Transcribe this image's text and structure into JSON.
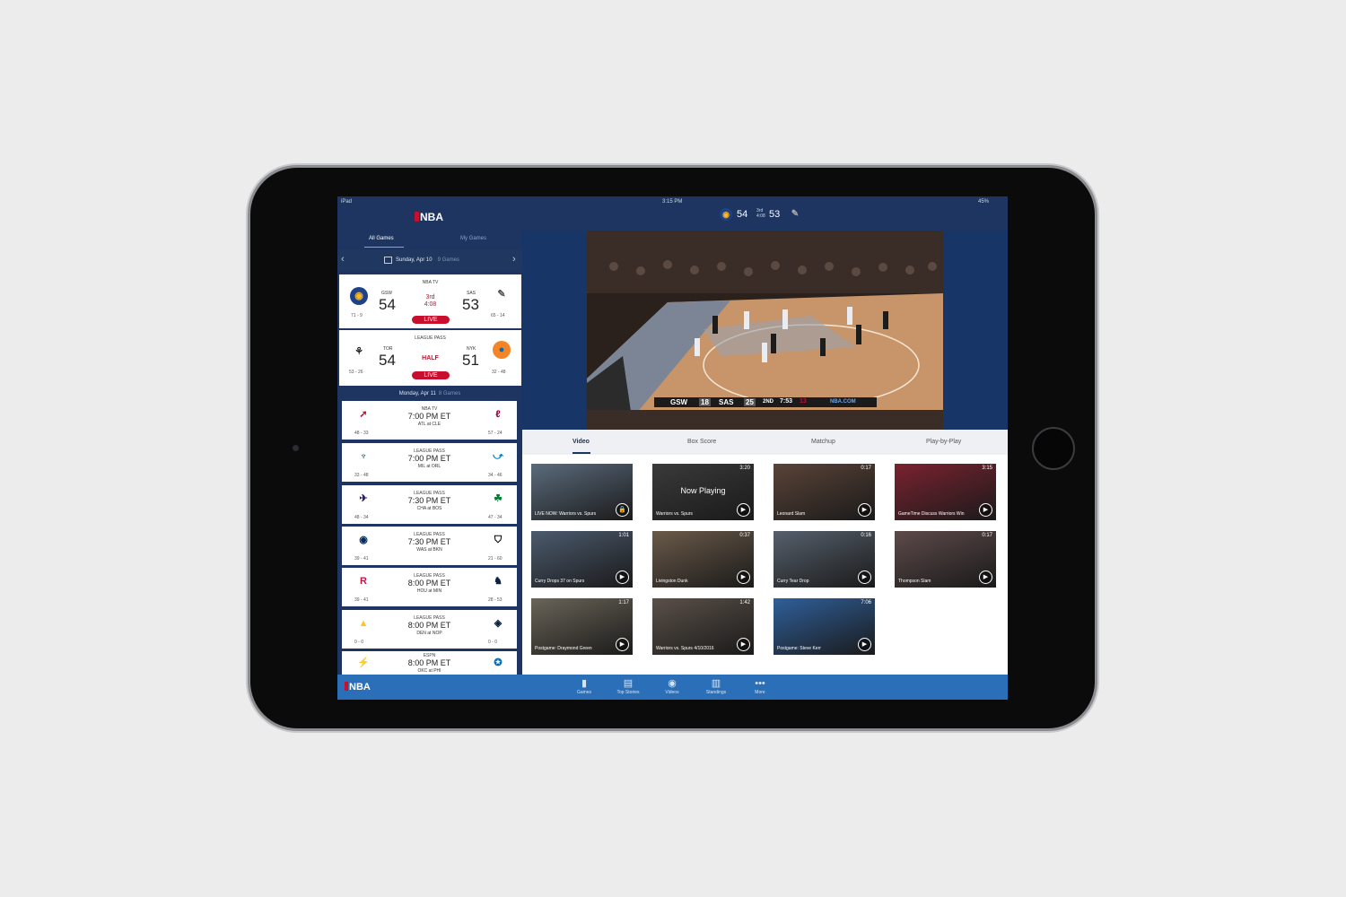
{
  "status": {
    "device": "iPad",
    "time": "3:15 PM",
    "battery": "45%"
  },
  "left": {
    "tabs": [
      "All Games",
      "My Games"
    ],
    "date": "Sunday, Apr 10",
    "date_games": "9 Games",
    "live_games": [
      {
        "network": "NBA TV",
        "away_abbr": "GSW",
        "away_score": "54",
        "away_record": "71 - 9",
        "period": "3rd",
        "clock": "4:08",
        "live": "LIVE",
        "home_abbr": "SAS",
        "home_score": "53",
        "home_record": "65 - 14"
      },
      {
        "network": "LEAGUE PASS",
        "away_abbr": "TOR",
        "away_score": "54",
        "away_record": "53 - 26",
        "period": "HALF",
        "live": "LIVE",
        "home_abbr": "NYK",
        "home_score": "51",
        "home_record": "32 - 48"
      }
    ],
    "day2": "Monday, Apr 11",
    "day2_games": "8 Games",
    "scheduled": [
      {
        "network": "NBA TV",
        "time": "7:00 PM ET",
        "matchup": "ATL at CLE",
        "away_record": "48 - 33",
        "home_record": "57 - 24"
      },
      {
        "network": "LEAGUE PASS",
        "time": "7:00 PM ET",
        "matchup": "MIL at ORL",
        "away_record": "33 - 48",
        "home_record": "34 - 46"
      },
      {
        "network": "LEAGUE PASS",
        "time": "7:30 PM ET",
        "matchup": "CHA at BOS",
        "away_record": "48 - 34",
        "home_record": "47 - 34"
      },
      {
        "network": "LEAGUE PASS",
        "time": "7:30 PM ET",
        "matchup": "WAS at BKN",
        "away_record": "39 - 41",
        "home_record": "21 - 60"
      },
      {
        "network": "LEAGUE PASS",
        "time": "8:00 PM ET",
        "matchup": "HOU at MIN",
        "away_record": "39 - 41",
        "home_record": "28 - 53"
      },
      {
        "network": "LEAGUE PASS",
        "time": "8:00 PM ET",
        "matchup": "DEN at NOP",
        "away_record": "0 - 0",
        "home_record": "0 - 0"
      },
      {
        "network": "ESPN",
        "time": "8:00 PM ET",
        "matchup": "OKC at PHI",
        "away_record": "",
        "home_record": ""
      }
    ]
  },
  "header": {
    "away_score": "54",
    "period": "3rd",
    "clock": "4:08",
    "home_score": "53"
  },
  "scorebug": {
    "away": "GSW",
    "away_score": "18",
    "home": "SAS",
    "home_score": "25",
    "period": "2ND",
    "clock": "7:53",
    "shot": "13",
    "brand": "NBA.COM"
  },
  "content_tabs": [
    "Video",
    "Box Score",
    "Matchup",
    "Play-by-Play"
  ],
  "videos": [
    {
      "caption": "LIVE NOW: Warriors vs. Spurs",
      "duration": "",
      "bg": "#5b6b7c"
    },
    {
      "caption": "Warriors vs. Spurs",
      "duration": "3:20",
      "bg": "#3a3a3a",
      "overlay": "Now Playing"
    },
    {
      "caption": "Leonard Slam",
      "duration": "0:17",
      "bg": "#5a4338"
    },
    {
      "caption": "GameTime Discuss Warriors Win",
      "duration": "3:15",
      "bg": "#7a2230"
    },
    {
      "caption": "Curry Drops 37 on Spurs",
      "duration": "1:01",
      "bg": "#4c5a6d"
    },
    {
      "caption": "Livingston Dunk",
      "duration": "0:37",
      "bg": "#6b5a4a"
    },
    {
      "caption": "Curry Tear Drop",
      "duration": "0:16",
      "bg": "#56606c"
    },
    {
      "caption": "Thompson Slam",
      "duration": "0:17",
      "bg": "#5d4a4a"
    },
    {
      "caption": "Postgame: Draymond Green",
      "duration": "1:17",
      "bg": "#6a6458"
    },
    {
      "caption": "Warriors vs. Spurs 4/10/2016",
      "duration": "1:42",
      "bg": "#5a5048"
    },
    {
      "caption": "Postgame: Steve Kerr",
      "duration": "7:06",
      "bg": "#2f5f9a"
    }
  ],
  "tabbar": {
    "items": [
      "Games",
      "Top Stories",
      "Videos",
      "Standings",
      "More"
    ],
    "brand": "NBA"
  },
  "colors": {
    "navy": "#1d3560",
    "red": "#c8102e",
    "blue": "#2a6fb8"
  }
}
